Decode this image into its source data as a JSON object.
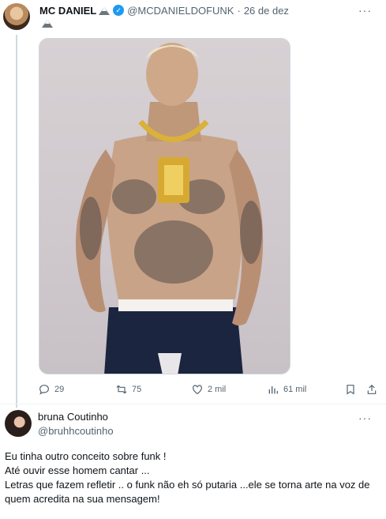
{
  "tweet": {
    "author_name": "MC DANIEL",
    "author_handle": "@MCDANIELDOFUNK",
    "separator": "·",
    "date": "26 de dez",
    "more_label": "···",
    "media_description_icon": "photo",
    "metrics": {
      "replies": "29",
      "retweets": "75",
      "likes": "2 mil",
      "views": "61 mil"
    }
  },
  "reply": {
    "author_name": "bruna Coutinho",
    "author_handle": "@bruhhcoutinho",
    "more_label": "···",
    "lines": [
      "Eu tinha outro conceito sobre funk !",
      "Até ouvir esse homem cantar ...",
      "Letras que fazem refletir .. o funk não eh só putaria ...ele se torna arte na voz de quem acredita na sua mensagem!"
    ]
  },
  "colors": {
    "accent": "#1d9bf0",
    "secondary_text": "#536471",
    "primary_text": "#0f1419",
    "divider": "#eff3f4"
  }
}
